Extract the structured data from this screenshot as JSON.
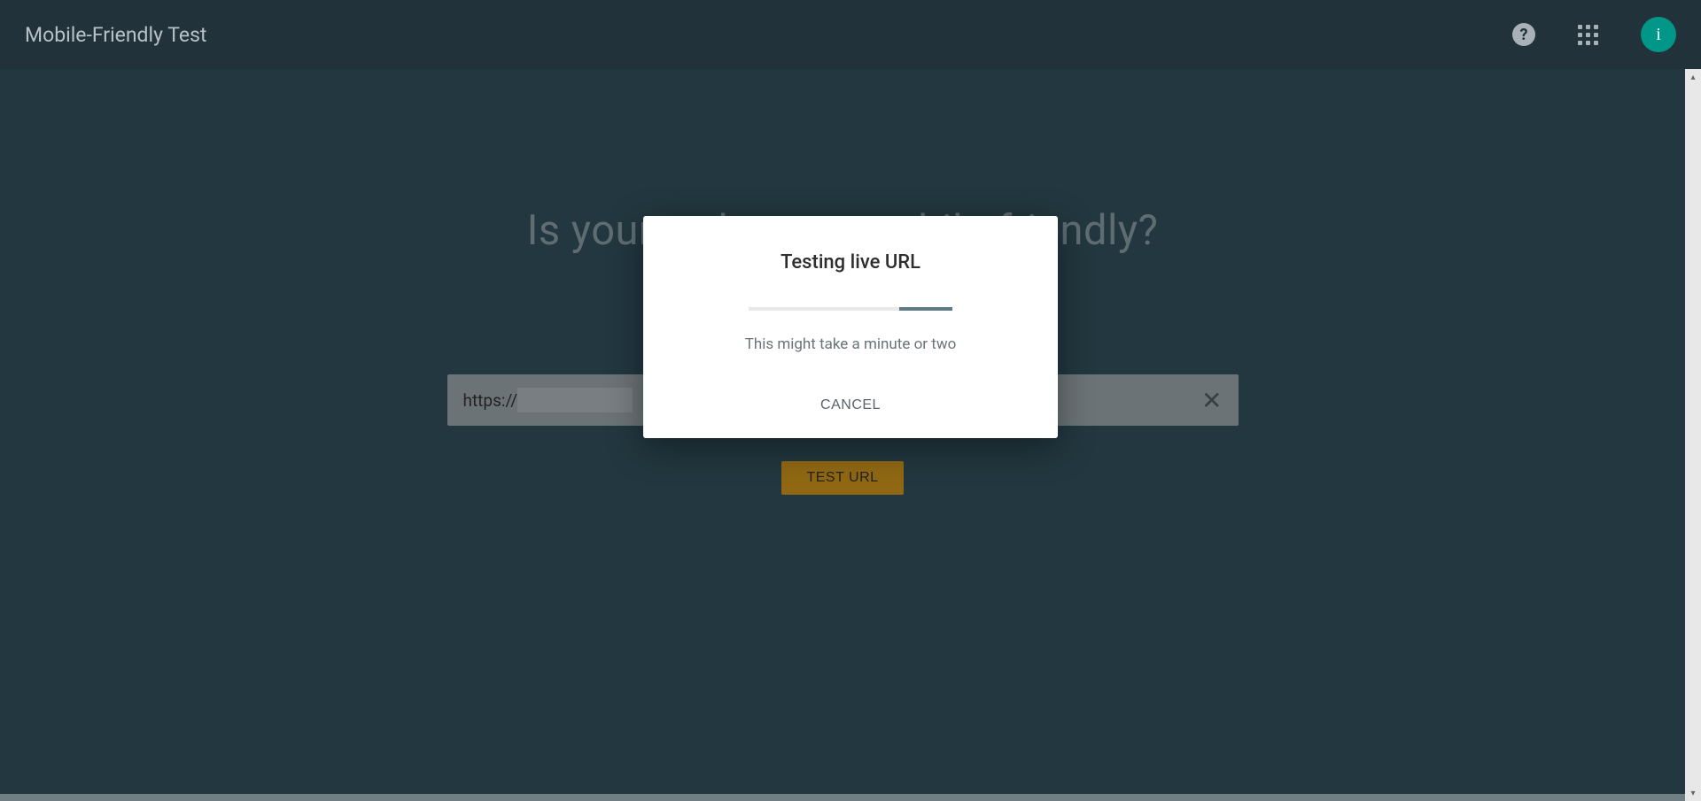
{
  "header": {
    "title": "Mobile-Friendly Test",
    "avatar_letter": "i"
  },
  "main": {
    "heading": "Is your web page mobile-friendly?",
    "url_input": {
      "prefix": "https://"
    },
    "test_button_label": "TEST URL"
  },
  "dialog": {
    "title": "Testing live URL",
    "subtitle": "This might take a minute or two",
    "cancel_label": "CANCEL"
  }
}
